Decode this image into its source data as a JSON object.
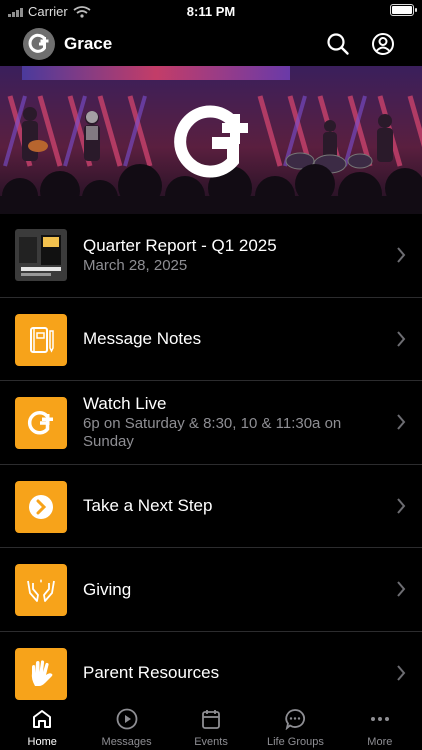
{
  "status_bar": {
    "carrier": "Carrier",
    "time": "8:11 PM"
  },
  "header": {
    "title": "Grace",
    "logo_icon": "grace-logo-icon",
    "actions": [
      "search-icon",
      "account-icon"
    ]
  },
  "hero": {
    "image": "worship-band-banner",
    "logo_icon": "grace-logo-icon"
  },
  "items": [
    {
      "title": "Quarter Report - Q1 2025",
      "subtitle": "March 28, 2025",
      "icon": "report-thumbnail"
    },
    {
      "title": "Message Notes",
      "subtitle": "",
      "icon": "notebook-icon"
    },
    {
      "title": "Watch Live",
      "subtitle": "6p on Saturday & 8:30, 10 & 11:30a on Sunday",
      "icon": "grace-logo-icon"
    },
    {
      "title": "Take a Next Step",
      "subtitle": "",
      "icon": "arrow-circle-icon"
    },
    {
      "title": "Giving",
      "subtitle": "",
      "icon": "giving-hands-icon"
    },
    {
      "title": "Parent Resources",
      "subtitle": "",
      "icon": "hand-print-icon"
    }
  ],
  "tabs": [
    {
      "label": "Home",
      "icon": "home-icon",
      "active": true
    },
    {
      "label": "Messages",
      "icon": "play-circle-icon",
      "active": false
    },
    {
      "label": "Events",
      "icon": "calendar-icon",
      "active": false
    },
    {
      "label": "Life Groups",
      "icon": "chat-bubble-icon",
      "active": false
    },
    {
      "label": "More",
      "icon": "more-dots-icon",
      "active": false
    }
  ],
  "colors": {
    "accent": "#f7a31a",
    "background": "#000000",
    "secondary_text": "#8e8e93"
  }
}
